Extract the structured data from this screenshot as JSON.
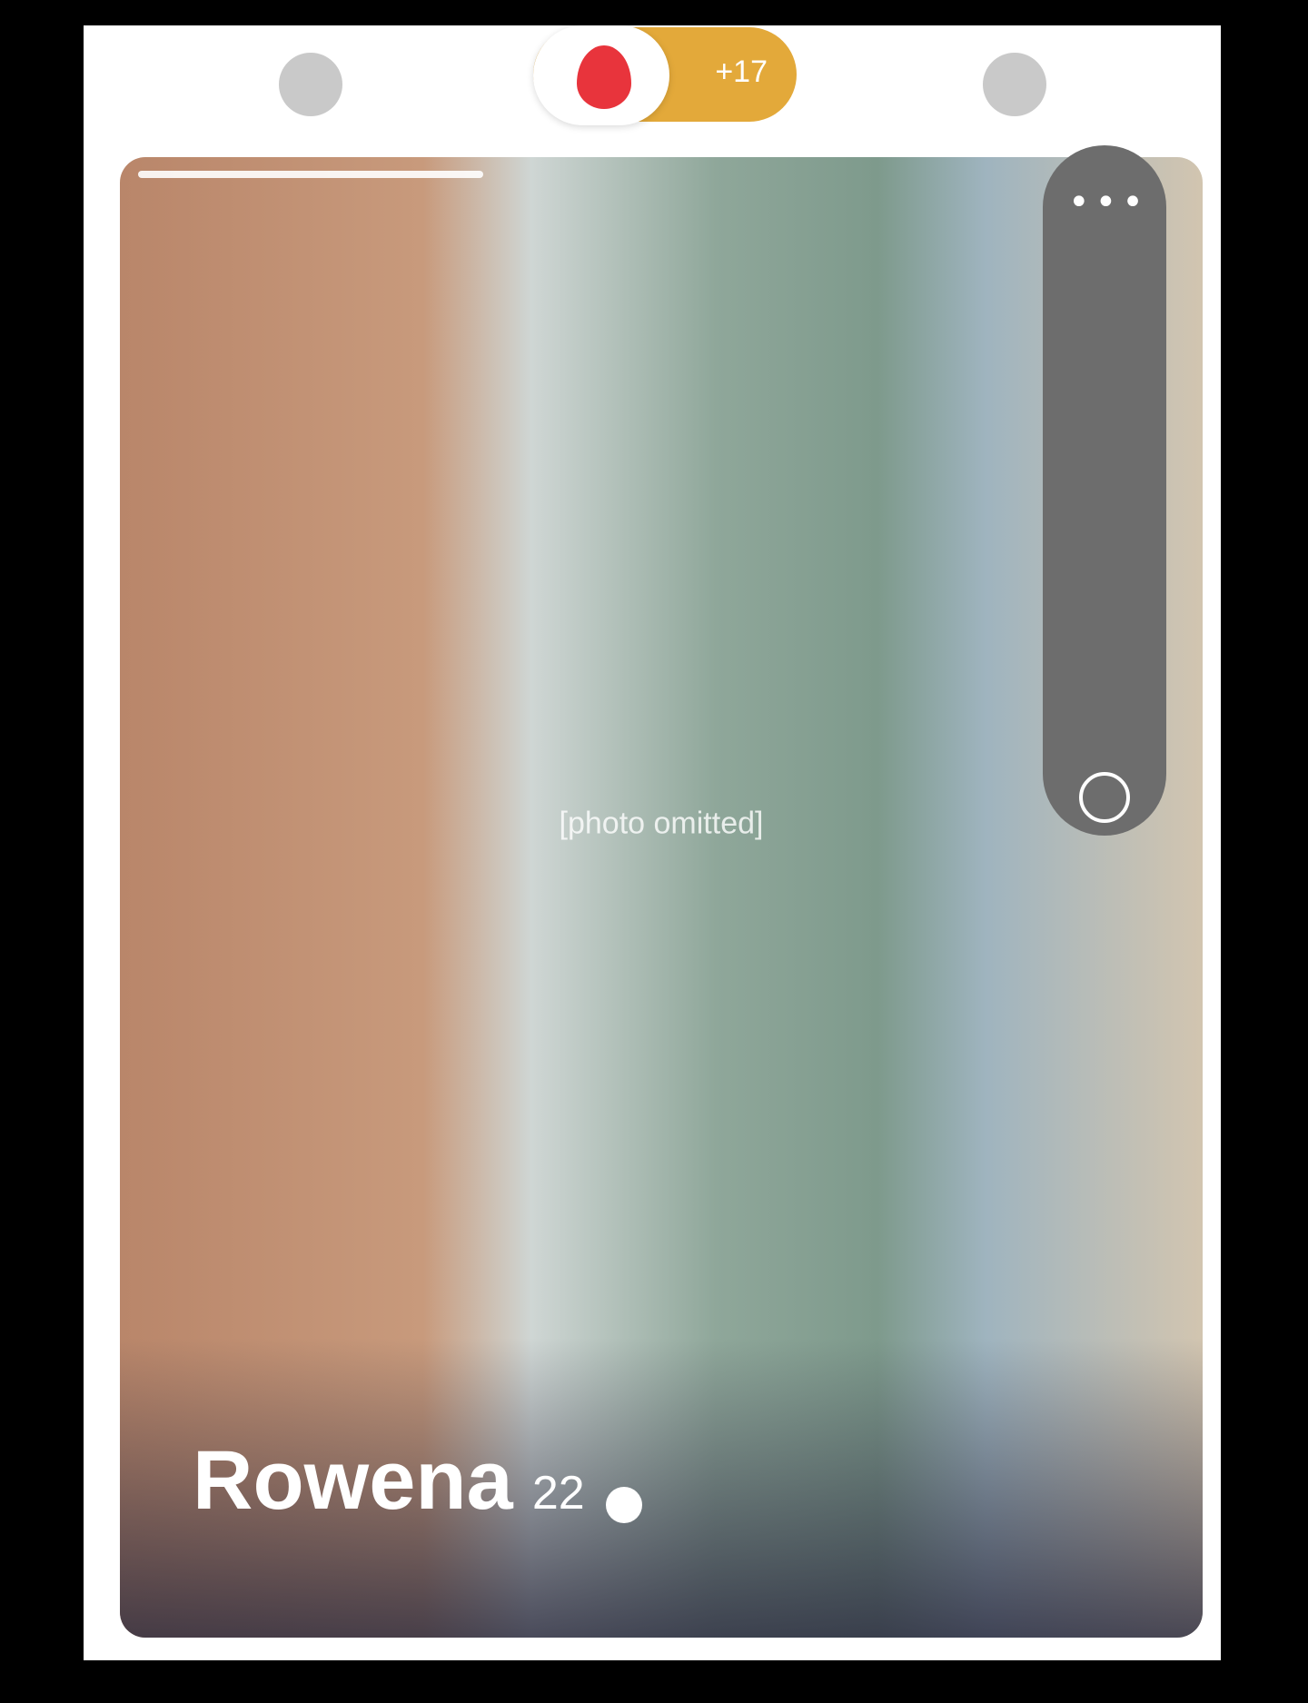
{
  "nav": {
    "count_label": "+17"
  },
  "card": {
    "name": "Rowena",
    "age": "22",
    "photo_note": "[photo omitted]"
  },
  "overlay": {
    "more_label": "•••"
  },
  "colors": {
    "brand_red": "#e8343c",
    "boost_gold": "#e3a93a"
  }
}
